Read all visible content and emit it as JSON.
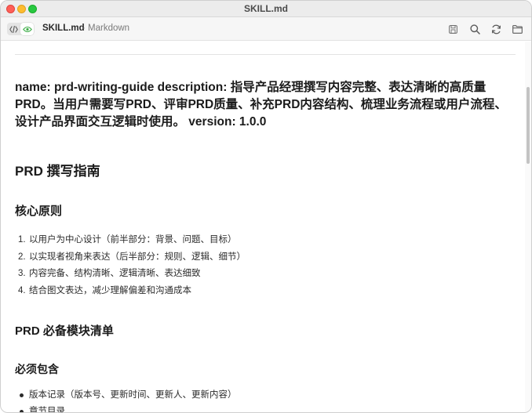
{
  "window": {
    "title": "SKILL.md"
  },
  "toolbar": {
    "file_name": "SKILL.md",
    "file_type": "· Markdown",
    "icons": [
      "code-view-icon",
      "preview-eye-icon",
      "save-icon",
      "search-icon",
      "refresh-icon",
      "folder-icon"
    ]
  },
  "doc": {
    "description": "name: prd-writing-guide description: 指导产品经理撰写内容完整、表达清晰的高质量PRD。当用户需要写PRD、评审PRD质量、补充PRD内容结构、梳理业务流程或用户流程、设计产品界面交互逻辑时使用。 version: 1.0.0",
    "title": "PRD 撰写指南",
    "section1": "核心原则",
    "principles": [
      "以用户为中心设计（前半部分：背景、问题、目标）",
      "以实现者视角来表达（后半部分：规则、逻辑、细节）",
      "内容完备、结构清晰、逻辑清晰、表达细致",
      "结合图文表达，减少理解偏差和沟通成本"
    ],
    "principle_numbers": [
      "1.",
      "2.",
      "3.",
      "4."
    ],
    "section2": "PRD 必备模块清单",
    "subsection": "必须包含",
    "modules": [
      "版本记录（版本号、更新时间、更新人、更新内容）",
      "章节目录"
    ]
  },
  "colors": {
    "close": "#fe5f57",
    "minimize": "#febc2e",
    "maximize": "#28c840",
    "accent": "#3fae49"
  }
}
